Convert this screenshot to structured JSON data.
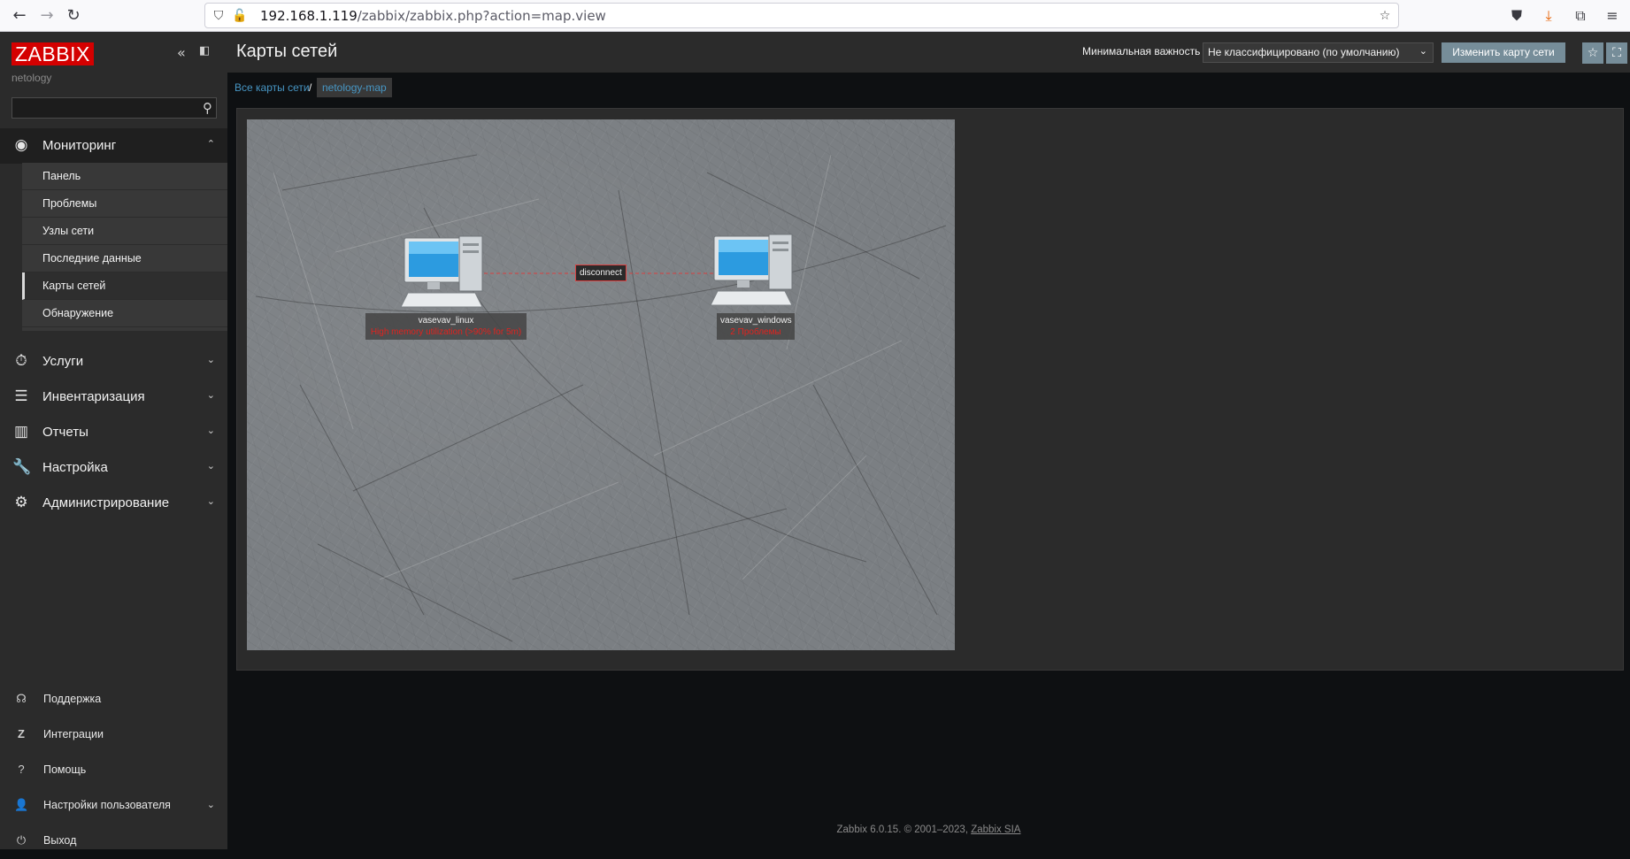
{
  "browser": {
    "url_host": "192.168.1.119",
    "url_path": "/zabbix/zabbix.php?action=map.view"
  },
  "sidebar": {
    "logo": "ZABBIX",
    "org": "netology",
    "search_value": "",
    "menu": [
      {
        "label": "Мониторинг",
        "icon": "eye-icon"
      },
      {
        "label": "Услуги",
        "icon": "stopwatch-icon"
      },
      {
        "label": "Инвентаризация",
        "icon": "list-icon"
      },
      {
        "label": "Отчеты",
        "icon": "bar-chart-icon"
      },
      {
        "label": "Настройка",
        "icon": "wrench-icon"
      },
      {
        "label": "Администрирование",
        "icon": "gear-icon"
      }
    ],
    "submenu": [
      {
        "label": "Панель"
      },
      {
        "label": "Проблемы"
      },
      {
        "label": "Узлы сети"
      },
      {
        "label": "Последние данные"
      },
      {
        "label": "Карты сетей"
      },
      {
        "label": "Обнаружение"
      }
    ],
    "bottom": [
      {
        "label": "Поддержка",
        "icon": "headset-icon"
      },
      {
        "label": "Интеграции",
        "icon": "z-icon"
      },
      {
        "label": "Помощь",
        "icon": "question-icon"
      },
      {
        "label": "Настройки пользователя",
        "icon": "user-icon"
      },
      {
        "label": "Выход",
        "icon": "power-icon"
      }
    ]
  },
  "header": {
    "title": "Карты сетей",
    "severity_label": "Минимальная важность",
    "severity_value": "Не классифицировано (по умолчанию)",
    "edit_button": "Изменить карту сети"
  },
  "breadcrumbs": {
    "all_maps": "Все карты сети",
    "separator": "/",
    "current": "netology-map"
  },
  "map": {
    "hosts": [
      {
        "name": "vasevav_linux",
        "problem": "High memory utilization (>90% for 5m)"
      },
      {
        "name": "vasevav_windows",
        "problem": "2 Проблемы"
      }
    ],
    "link_label": "disconnect",
    "link_color": "#d84040"
  },
  "footer": {
    "text": "Zabbix 6.0.15. © 2001–2023, ",
    "link": "Zabbix SIA"
  },
  "colors": {
    "accent": "#d40000",
    "link": "#4796c4",
    "button": "#768d99",
    "problem": "#e0231f"
  }
}
